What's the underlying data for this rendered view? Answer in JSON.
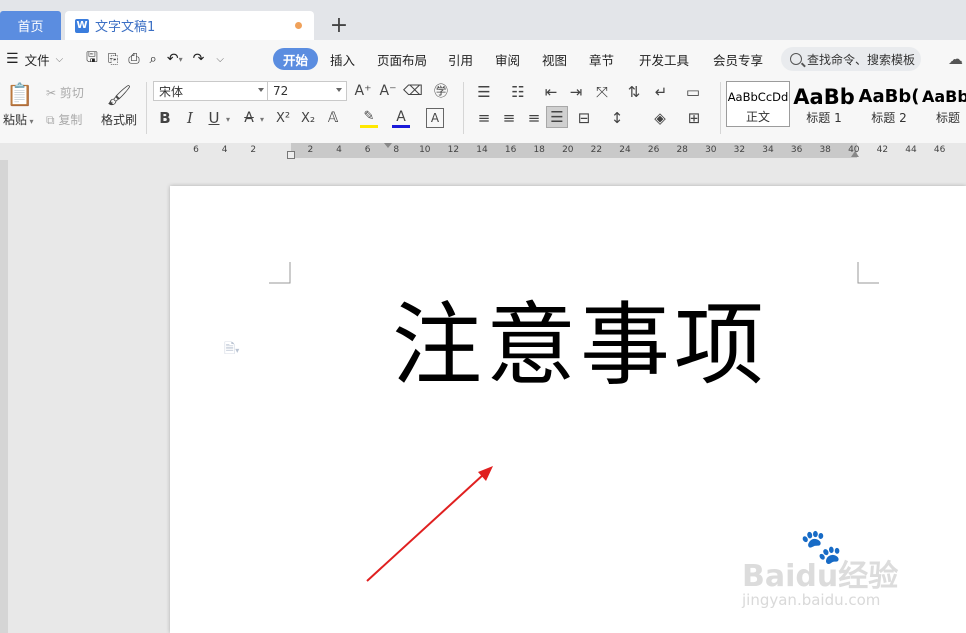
{
  "tabs": {
    "home": "首页",
    "doc_icon": "W",
    "doc_title": "文字文稿1",
    "new_tab": "+"
  },
  "menu": {
    "file": "文件",
    "items": [
      "开始",
      "插入",
      "页面布局",
      "引用",
      "审阅",
      "视图",
      "章节",
      "开发工具",
      "会员专享"
    ],
    "active": "开始",
    "search_placeholder": "查找命令、搜索模板"
  },
  "ribbon": {
    "paste": "粘贴",
    "cut": "剪切",
    "copy": "复制",
    "format_painter": "格式刷",
    "font_name": "宋体",
    "font_size": "72",
    "bold": "B",
    "italic": "I",
    "underline": "U",
    "superscript": "X²",
    "subscript": "X₂",
    "styles": [
      {
        "preview": "AaBbCcDd",
        "name": "正文"
      },
      {
        "preview": "AaBb",
        "name": "标题 1"
      },
      {
        "preview": "AaBb(",
        "name": "标题 2"
      },
      {
        "preview": "AaBb",
        "name": "标题"
      }
    ]
  },
  "ruler": {
    "ticks": [
      "6",
      "4",
      "2",
      "",
      "2",
      "4",
      "6",
      "8",
      "10",
      "12",
      "14",
      "16",
      "18",
      "20",
      "22",
      "24",
      "26",
      "28",
      "30",
      "32",
      "34",
      "36",
      "38",
      "40",
      "42",
      "44",
      "46"
    ]
  },
  "document": {
    "heading": "注意事项"
  },
  "watermark": {
    "brand": "Baidu经验",
    "url": "jingyan.baidu.com"
  },
  "colors": {
    "accent": "#5b8de0",
    "arrow": "#e02020"
  }
}
